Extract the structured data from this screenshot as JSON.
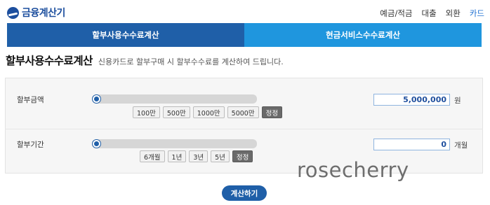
{
  "app": {
    "logo_text": "금융계산기",
    "top_nav": [
      "예금/적금",
      "대출",
      "외환",
      "카드"
    ],
    "active_nav": "카드"
  },
  "tabs": [
    {
      "label": "할부사용수수료계산",
      "active": true
    },
    {
      "label": "현금서비스수수료계산",
      "active": false
    }
  ],
  "page": {
    "title": "할부사용수수료계산",
    "description": "신용카드로 할부구매 시 할부수수료를 계산하여 드립니다."
  },
  "amount_row": {
    "label": "할부금액",
    "slider_level": 0,
    "quick_buttons": [
      "100만",
      "500만",
      "1000만",
      "5000만"
    ],
    "reset_label": "정정",
    "value": "5,000,000",
    "unit": "원"
  },
  "period_row": {
    "label": "할부기간",
    "slider_level": 0,
    "quick_buttons": [
      "6개월",
      "1년",
      "3년",
      "5년"
    ],
    "reset_label": "정정",
    "value": "0",
    "unit": "개월"
  },
  "watermark": "rosecherry",
  "calculate_label": "계산하기",
  "colors": {
    "brand": "#1d4f9e",
    "tab_active": "#1f5fa8",
    "tab_inactive": "#1f96de",
    "accent_nav": "#1d6fd1"
  }
}
